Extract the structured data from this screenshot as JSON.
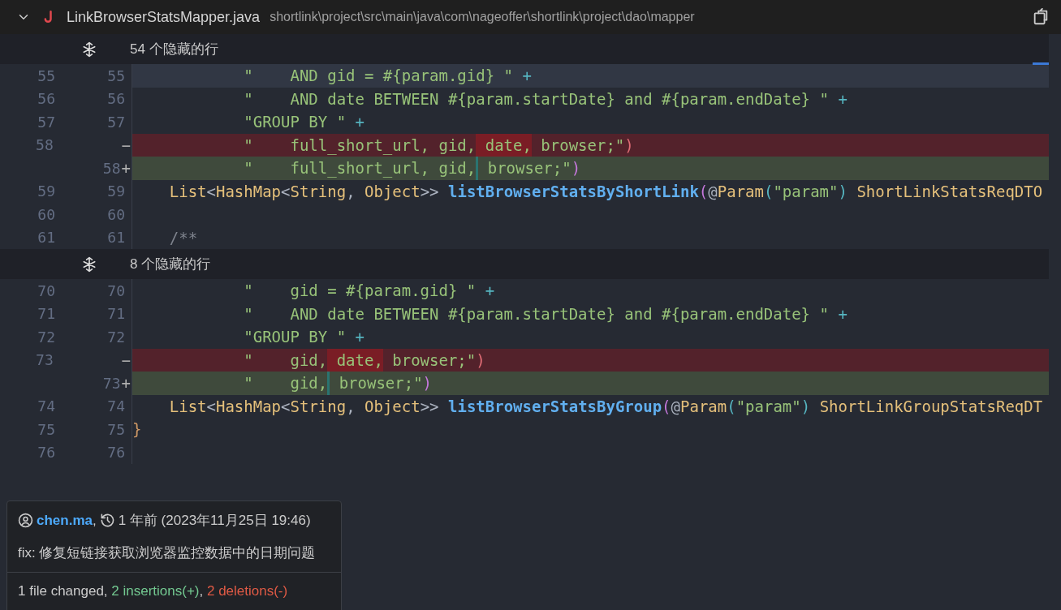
{
  "file_header": {
    "expanded": true,
    "file_name": "LinkBrowserStatsMapper.java",
    "path": "shortlink\\project\\src\\main\\java\\com\\nageoffer\\shortlink\\project\\dao\\mapper"
  },
  "hunks": [
    {
      "hidden_label": "54 个隐藏的行",
      "lines": [
        {
          "old": "55",
          "new": "55",
          "kind": "context",
          "current": true,
          "tokens": [
            {
              "t": "            \"    AND gid = #{param.gid} \"",
              "kind": "str"
            },
            {
              "t": " +",
              "kind": "op"
            }
          ]
        },
        {
          "old": "56",
          "new": "56",
          "kind": "context",
          "current": false,
          "tokens": [
            {
              "t": "            \"    AND date BETWEEN #{param.startDate} and #{param.endDate} \"",
              "kind": "str"
            },
            {
              "t": " +",
              "kind": "op"
            }
          ]
        },
        {
          "old": "57",
          "new": "57",
          "kind": "context",
          "current": false,
          "tokens": [
            {
              "t": "            \"GROUP BY \"",
              "kind": "str"
            },
            {
              "t": " +",
              "kind": "op"
            }
          ]
        },
        {
          "old": "58",
          "kind": "deleted",
          "marker": "−",
          "current": false,
          "tokens": [
            {
              "t": "            \"    full_short_url, gid,",
              "kind": "str"
            },
            {
              "t": " date,",
              "kind": "str",
              "changed": true
            },
            {
              "t": " browser;\"",
              "kind": "str"
            },
            {
              "t": ")",
              "kind": "bracket3"
            }
          ]
        },
        {
          "new": "58",
          "kind": "added",
          "marker": "+",
          "current": false,
          "tokens": [
            {
              "t": "            \"    full_short_url, gid,",
              "kind": "str"
            },
            {
              "t": " browser;\"",
              "kind": "str",
              "insertion_point": true
            },
            {
              "t": ")",
              "kind": "bracket1"
            }
          ]
        },
        {
          "old": "59",
          "new": "59",
          "kind": "context",
          "current": false,
          "tokens": [
            {
              "t": "    List",
              "kind": "type"
            },
            {
              "t": "<",
              "kind": "punct"
            },
            {
              "t": "HashMap",
              "kind": "type"
            },
            {
              "t": "<",
              "kind": "punct"
            },
            {
              "t": "String",
              "kind": "type"
            },
            {
              "t": ", ",
              "kind": "punct"
            },
            {
              "t": "Object",
              "kind": "type"
            },
            {
              "t": ">> ",
              "kind": "punct"
            },
            {
              "t": "listBrowserStatsByShortLink",
              "kind": "fn"
            },
            {
              "t": "(",
              "kind": "bracket1"
            },
            {
              "t": "@",
              "kind": "punct"
            },
            {
              "t": "Param",
              "kind": "type"
            },
            {
              "t": "(",
              "kind": "bracket2"
            },
            {
              "t": "\"param\"",
              "kind": "str"
            },
            {
              "t": ")",
              "kind": "bracket2"
            },
            {
              "t": " ShortLinkStatsReqDTO",
              "kind": "type"
            }
          ]
        },
        {
          "old": "60",
          "new": "60",
          "kind": "context",
          "current": false
        },
        {
          "old": "61",
          "new": "61",
          "kind": "context",
          "current": false,
          "tokens": [
            {
              "t": "    /**",
              "kind": "comment"
            }
          ]
        }
      ]
    },
    {
      "hidden_label": "8 个隐藏的行",
      "lines": [
        {
          "old": "70",
          "new": "70",
          "kind": "context",
          "current": false,
          "tokens": [
            {
              "t": "            \"    gid = #{param.gid} \"",
              "kind": "str"
            },
            {
              "t": " +",
              "kind": "op"
            }
          ]
        },
        {
          "old": "71",
          "new": "71",
          "kind": "context",
          "current": false,
          "tokens": [
            {
              "t": "            \"    AND date BETWEEN #{param.startDate} and #{param.endDate} \"",
              "kind": "str"
            },
            {
              "t": " +",
              "kind": "op"
            }
          ]
        },
        {
          "old": "72",
          "new": "72",
          "kind": "context",
          "current": false,
          "tokens": [
            {
              "t": "            \"GROUP BY \"",
              "kind": "str"
            },
            {
              "t": " +",
              "kind": "op"
            }
          ]
        },
        {
          "old": "73",
          "kind": "deleted",
          "marker": "−",
          "current": false,
          "tokens": [
            {
              "t": "            \"    gid,",
              "kind": "str"
            },
            {
              "t": " date,",
              "kind": "str",
              "changed": true
            },
            {
              "t": " browser;\"",
              "kind": "str"
            },
            {
              "t": ")",
              "kind": "bracket3"
            }
          ]
        },
        {
          "new": "73",
          "kind": "added",
          "marker": "+",
          "current": false,
          "tokens": [
            {
              "t": "            \"    gid,",
              "kind": "str"
            },
            {
              "t": " browser;\"",
              "kind": "str",
              "insertion_point": true
            },
            {
              "t": ")",
              "kind": "bracket1"
            }
          ]
        },
        {
          "old": "74",
          "new": "74",
          "kind": "context",
          "current": false,
          "tokens": [
            {
              "t": "    List",
              "kind": "type"
            },
            {
              "t": "<",
              "kind": "punct"
            },
            {
              "t": "HashMap",
              "kind": "type"
            },
            {
              "t": "<",
              "kind": "punct"
            },
            {
              "t": "String",
              "kind": "type"
            },
            {
              "t": ", ",
              "kind": "punct"
            },
            {
              "t": "Object",
              "kind": "type"
            },
            {
              "t": ">> ",
              "kind": "punct"
            },
            {
              "t": "listBrowserStatsByGroup",
              "kind": "fn"
            },
            {
              "t": "(",
              "kind": "bracket1"
            },
            {
              "t": "@",
              "kind": "punct"
            },
            {
              "t": "Param",
              "kind": "type"
            },
            {
              "t": "(",
              "kind": "bracket2"
            },
            {
              "t": "\"param\"",
              "kind": "str"
            },
            {
              "t": ")",
              "kind": "bracket2"
            },
            {
              "t": " ShortLinkGroupStatsReqDT",
              "kind": "type"
            }
          ]
        },
        {
          "old": "75",
          "new": "75",
          "kind": "context",
          "current": false,
          "tokens": [
            {
              "t": "}",
              "kind": "brace"
            }
          ]
        },
        {
          "old": "76",
          "new": "76",
          "kind": "context",
          "current": false
        }
      ]
    }
  ],
  "commit_popup": {
    "author": "chen.ma",
    "author_suffix": ",",
    "time": "1 年前 (2023年11月25日 19:46)",
    "message": "fix: 修复短链接获取浏览器监控数据中的日期问题",
    "stats": {
      "files": "1 file changed,",
      "insertions": "2 insertions(+)",
      "separator": ",",
      "deletions": "2 deletions(-)"
    }
  }
}
